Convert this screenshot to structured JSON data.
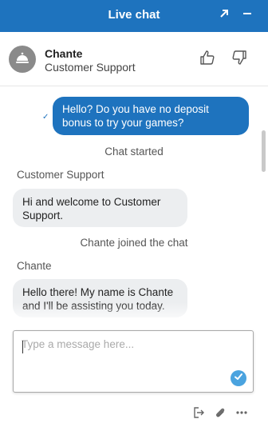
{
  "header": {
    "title": "Live chat",
    "expand_icon": "expand-arrow-icon",
    "minimize_icon": "minimize-icon"
  },
  "agent": {
    "name": "Chante",
    "role": "Customer Support",
    "avatar_icon": "service-bell-icon",
    "thumbs_up_icon": "thumbs-up-icon",
    "thumbs_down_icon": "thumbs-down-icon"
  },
  "messages": {
    "visitor_message": "Hello? Do you have no deposit bonus to try your games?",
    "delivered_mark": "✓",
    "chat_started": "Chat started",
    "sender_support": "Customer Support",
    "support_message": "Hi and welcome to Customer Support.",
    "agent_joined": "Chante joined the chat",
    "sender_agent": "Chante",
    "agent_message": "Hello there! My name is Chante and I'll be assisting you today."
  },
  "composer": {
    "placeholder": "Type a message here...",
    "value": "",
    "send_icon": "send-check-icon"
  },
  "footer": {
    "transfer_icon": "exit-door-icon",
    "attach_icon": "paperclip-icon",
    "more_icon": "more-dots-icon"
  },
  "colors": {
    "brand": "#1e73be",
    "send": "#4aa3df",
    "bubble_in": "#eceef0"
  }
}
